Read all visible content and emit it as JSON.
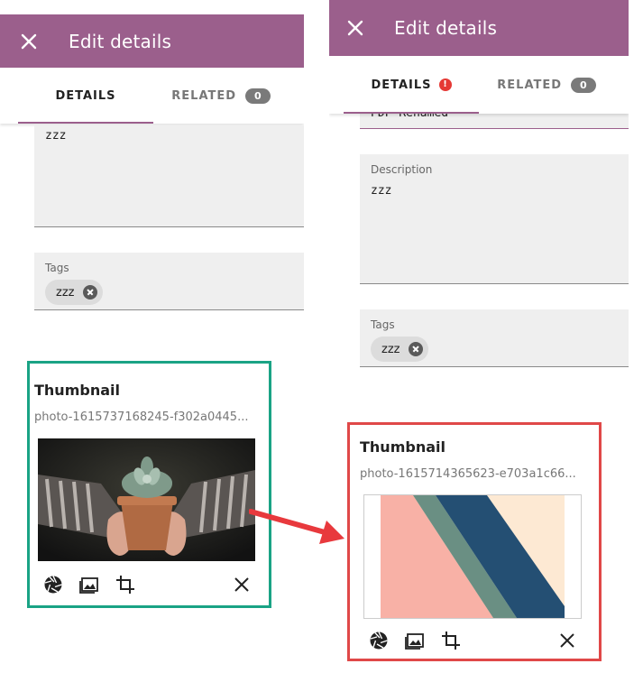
{
  "colors": {
    "appbar": "#9b5f8c",
    "tab_indicator": "#9b5f8c",
    "error_badge": "#e53935",
    "highlight_left": "#1aa385",
    "highlight_right": "#e04848",
    "arrow": "#e8393d"
  },
  "left": {
    "appbar": {
      "title": "Edit details",
      "close_icon": "close-icon"
    },
    "tabs": {
      "details": "DETAILS",
      "related": "RELATED",
      "related_count": "0"
    },
    "description": {
      "value": "zzz"
    },
    "tags": {
      "label": "Tags",
      "chip": "zzz"
    },
    "thumbnail": {
      "title": "Thumbnail",
      "filename": "photo-1615737168245-f302a0445...",
      "image": "succulent-plant-in-hands"
    }
  },
  "right": {
    "appbar": {
      "title": "Edit details",
      "close_icon": "close-icon"
    },
    "tabs": {
      "details": "DETAILS",
      "error_mark": "!",
      "related": "RELATED",
      "related_count": "0"
    },
    "name": {
      "value": "PDF Renamed"
    },
    "description": {
      "label": "Description",
      "value": "zzz"
    },
    "tags": {
      "label": "Tags",
      "chip": "zzz"
    },
    "thumbnail": {
      "title": "Thumbnail",
      "filename": "photo-1615714365623-e703a1c66...",
      "image": "diagonal-stripes-pattern"
    }
  }
}
